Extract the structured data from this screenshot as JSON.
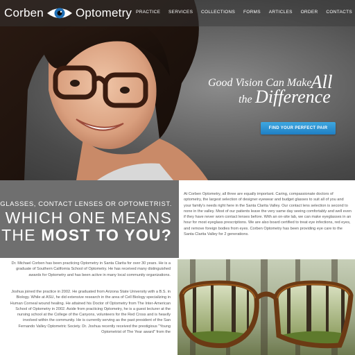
{
  "brand": {
    "left": "Corben",
    "right": "Optometry"
  },
  "nav": [
    "PRACTICE",
    "SERVICES",
    "COLLECTIONS",
    "FORMS",
    "ARTICLES",
    "ORDER",
    "CONTACTS"
  ],
  "hero": {
    "tagline_line1": "Good Vision Can Make",
    "tagline_big1": "All",
    "tagline_line2": "the",
    "tagline_big2": "Difference",
    "cta_label": "FIND YOUR PERFECT PAIR"
  },
  "question": {
    "small": "EYEGLASSES, CONTACT LENSES OR OPTOMETRIST.",
    "big_line1": "WHICH ONE MEANS",
    "big_line2_prefix": "THE ",
    "big_line2_emph": "MOST TO YOU?"
  },
  "intro_text": "At Corben Optometry, all three are equally important. Caring, compassionate doctors of optometry, the largest selection of designer eyewear and budget glasses to suit all of you and your family's needs right here in the Santa Clarita Valley. Our contact lens selection is second to none in the valley. Most of our patients leave the very same day seeing comfortably and well even if they have never worn contact lenses before. With an on-site lab, we can make eyeglasses in an hour for most eyeglass prescriptions. We are also board certified to treat eye infections, red eyes, and remove foreign bodies from eyes. Corben Optometry has been providing eye care to the Santa Clarita Valley for 2 generations.",
  "bio": {
    "p1": "Dr. Michael Corben has been practicing Optometry in Santa Clarita for over 30 years. He is a graduate of Southern California School of Optometry. He has received many distinguished awards for Optometry and has been active in many local community organizations.",
    "p2": "Joshua joined the practice in 2002. He graduated from Arizona State University with a B.S. in Biology. While at ASU, he did extensive research in the area of Cell Biology specializing in Human Corneal wound healing. He attained his Doctor of Optometry from The Inter-American School of Optometry in 2002. Aside from practicing Optometry, he is a guest lecturer at the nursing school at the College of the Canyons, volunteers for the Red Cross and is heavily involved within the community. He is currently serving as the past president of the San Fernando Valley Optometric Society. Dr. Joshua recently received the prestigious \"Young Optometrist of The Year award\" from the"
  },
  "colors": {
    "question_bg": "#6f6f6f",
    "cta_blue": "#2a8fd2",
    "text_gray": "#555555",
    "logo_blue": "#1f6fb5"
  },
  "icons": {
    "logo": "eye-icon"
  }
}
